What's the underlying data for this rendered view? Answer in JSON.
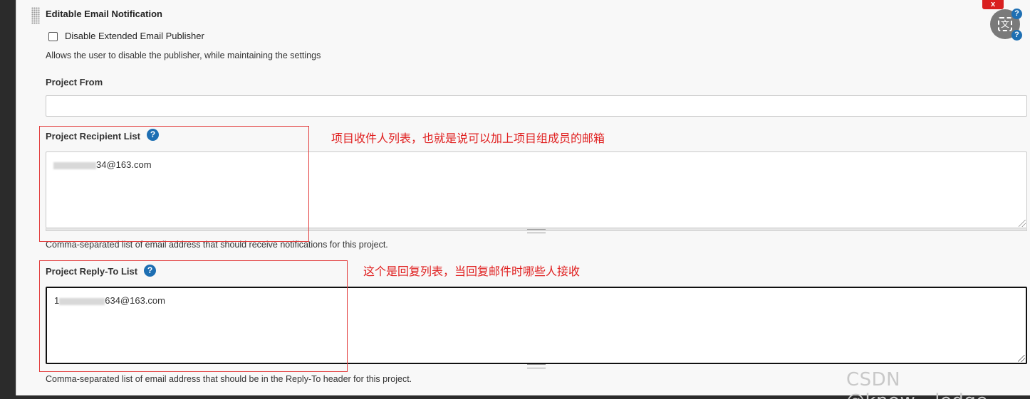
{
  "section": {
    "title": "Editable Email Notification"
  },
  "disable_publisher": {
    "label": "Disable Extended Email Publisher",
    "checked": false,
    "description": "Allows the user to disable the publisher, while maintaining the settings"
  },
  "project_from": {
    "label": "Project From",
    "value": ""
  },
  "recipient_list": {
    "label": "Project Recipient List",
    "help_icon": "?",
    "value_prefix": "",
    "value_suffix": "34@163.com",
    "description": "Comma-separated list of email address that should receive notifications for this project."
  },
  "reply_to_list": {
    "label": "Project Reply-To List",
    "help_icon": "?",
    "value_prefix": "1",
    "value_suffix": "634@163.com",
    "description": "Comma-separated list of email address that should be in the Reply-To header for this project."
  },
  "annotations": {
    "recipient_note": "项目收件人列表，也就是说可以加上项目组成员的邮箱",
    "reply_to_note": "这个是回复列表，当回复邮件时哪些人接收"
  },
  "overlay": {
    "close_label": "x",
    "translate_char": "文",
    "help_icon": "?"
  },
  "watermark": "CSDN @know__ledge",
  "colors": {
    "annotation_red": "#e02020",
    "help_blue": "#1e6fb3",
    "close_red": "#d92020"
  }
}
